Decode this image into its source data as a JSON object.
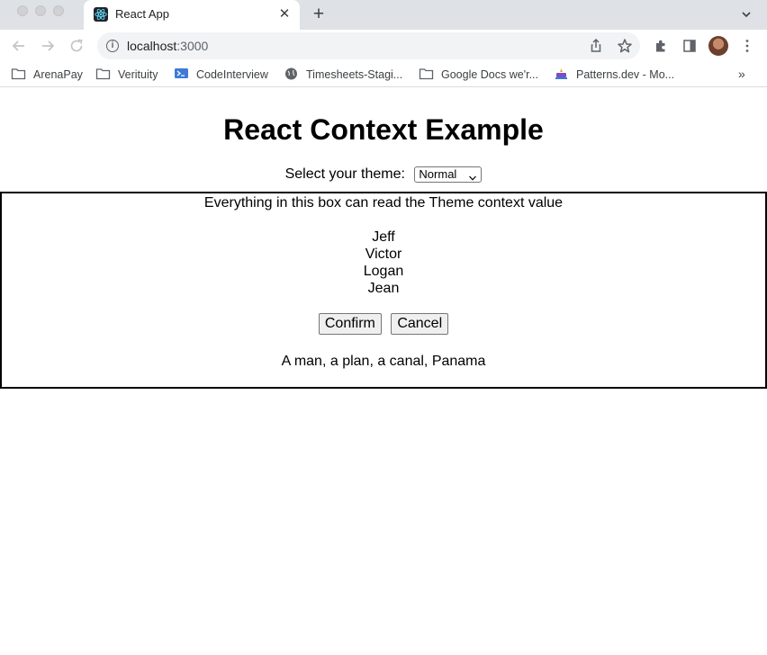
{
  "browser": {
    "tab_title": "React App",
    "tab_close": "✕",
    "new_tab": "+",
    "url_host": "localhost",
    "url_port": ":3000",
    "info_glyph": "i",
    "icons": [
      "back-icon",
      "forward-icon",
      "reload-icon",
      "info-icon",
      "share-icon",
      "star-icon",
      "extensions-icon",
      "side-panel-icon",
      "profile-avatar",
      "more-icon",
      "tab-list-icon"
    ],
    "bookmarks": [
      {
        "label": "ArenaPay",
        "icon": "folder-icon"
      },
      {
        "label": "Verituity",
        "icon": "folder-icon"
      },
      {
        "label": "CodeInterview",
        "icon": "terminal-icon"
      },
      {
        "label": "Timesheets-Stagi...",
        "icon": "globe-icon"
      },
      {
        "label": "Google Docs we'r...",
        "icon": "folder-icon"
      },
      {
        "label": "Patterns.dev - Mo...",
        "icon": "patterns-icon"
      }
    ],
    "bookmarks_more": "»"
  },
  "page": {
    "heading": "React Context Example",
    "theme_label": "Select your theme:",
    "theme_selected": "Normal",
    "box_text": "Everything in this box can read the Theme context value",
    "names": [
      "Jeff",
      "Victor",
      "Logan",
      "Jean"
    ],
    "confirm_label": "Confirm",
    "cancel_label": "Cancel",
    "palindrome": "A man, a plan, a canal, Panama"
  },
  "colors": {
    "tabstrip_bg": "#dee1e6",
    "omnibox_bg": "#f1f3f4",
    "react_blue": "#61dafb",
    "codeinterview_blue": "#3e7bd6"
  }
}
